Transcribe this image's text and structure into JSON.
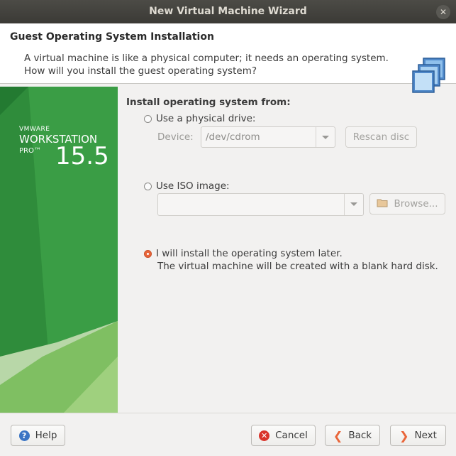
{
  "window": {
    "title": "New Virtual Machine Wizard"
  },
  "header": {
    "title": "Guest Operating System Installation",
    "desc_line1": "A virtual machine is like a physical computer; it needs an operating system.",
    "desc_line2": "How will you install the guest operating system?"
  },
  "brand": {
    "vendor": "VMWARE",
    "product": "WORKSTATION",
    "edition": "PRO™",
    "version": "15.5"
  },
  "install": {
    "section_title": "Install operating system from:",
    "physical": {
      "label": "Use a physical drive:",
      "device_label": "Device:",
      "device_value": "/dev/cdrom",
      "rescan_label": "Rescan disc",
      "selected": false
    },
    "iso": {
      "label": "Use ISO image:",
      "path_value": "",
      "browse_label": "Browse...",
      "selected": false
    },
    "later": {
      "label": "I will install the operating system later.",
      "sublabel": "The virtual machine will be created with a blank hard disk.",
      "selected": true
    }
  },
  "footer": {
    "help_label": "Help",
    "cancel_label": "Cancel",
    "back_label": "Back",
    "next_label": "Next"
  },
  "colors": {
    "accent": "#e9663a",
    "vmware_green": "#2e8b3a",
    "titlebar": "#3b3a36"
  }
}
